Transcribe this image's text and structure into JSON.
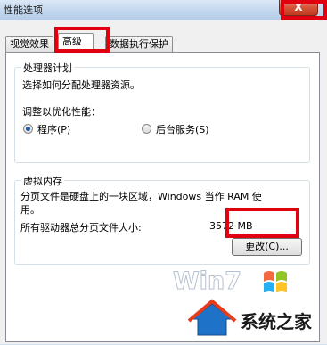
{
  "window": {
    "title": "性能选项",
    "close_label": "X"
  },
  "tabs": [
    {
      "label": "视觉效果",
      "active": false
    },
    {
      "label": "高级",
      "active": true
    },
    {
      "label": "数据执行保护",
      "active": false
    }
  ],
  "processor_scheduling": {
    "title": "处理器计划",
    "description": "选择如何分配处理器资源。",
    "adjust_label": "调整以优化性能：",
    "options": [
      {
        "label": "程序(P)",
        "checked": true
      },
      {
        "label": "后台服务(S)",
        "checked": false
      }
    ]
  },
  "virtual_memory": {
    "title": "虚拟内存",
    "description_line1": "分页文件是硬盘上的一块区域，Windows 当作 RAM 使",
    "description_line2": "用。",
    "total_label": "所有驱动器总分页文件大小:",
    "total_value": "3572 MB",
    "change_button": "更改(C)..."
  },
  "watermark": {
    "brand": "Win7",
    "site": "系统之家"
  },
  "colors": {
    "highlight": "#e0000f",
    "radio_dot": "#1b59a6"
  }
}
